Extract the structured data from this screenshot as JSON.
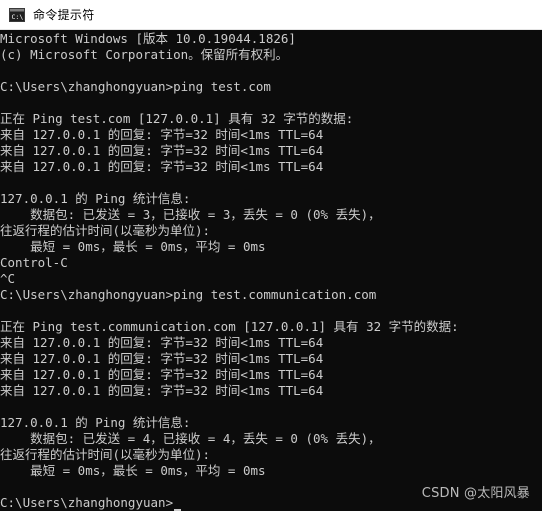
{
  "window": {
    "title": "命令提示符",
    "icon": "terminal-icon"
  },
  "console": {
    "lines": [
      "Microsoft Windows [版本 10.0.19044.1826]",
      "(c) Microsoft Corporation。保留所有权利。",
      "",
      "C:\\Users\\zhanghongyuan>ping test.com",
      "",
      "正在 Ping test.com [127.0.0.1] 具有 32 字节的数据:",
      "来自 127.0.0.1 的回复: 字节=32 时间<1ms TTL=64",
      "来自 127.0.0.1 的回复: 字节=32 时间<1ms TTL=64",
      "来自 127.0.0.1 的回复: 字节=32 时间<1ms TTL=64",
      "",
      "127.0.0.1 的 Ping 统计信息:",
      "    数据包: 已发送 = 3，已接收 = 3，丢失 = 0 (0% 丢失)，",
      "往返行程的估计时间(以毫秒为单位):",
      "    最短 = 0ms，最长 = 0ms，平均 = 0ms",
      "Control-C",
      "^C",
      "C:\\Users\\zhanghongyuan>ping test.communication.com",
      "",
      "正在 Ping test.communication.com [127.0.0.1] 具有 32 字节的数据:",
      "来自 127.0.0.1 的回复: 字节=32 时间<1ms TTL=64",
      "来自 127.0.0.1 的回复: 字节=32 时间<1ms TTL=64",
      "来自 127.0.0.1 的回复: 字节=32 时间<1ms TTL=64",
      "来自 127.0.0.1 的回复: 字节=32 时间<1ms TTL=64",
      "",
      "127.0.0.1 的 Ping 统计信息:",
      "    数据包: 已发送 = 4，已接收 = 4，丢失 = 0 (0% 丢失)，",
      "往返行程的估计时间(以毫秒为单位):",
      "    最短 = 0ms，最长 = 0ms，平均 = 0ms",
      "",
      "C:\\Users\\zhanghongyuan>"
    ]
  },
  "watermark": {
    "text": "CSDN @太阳风暴"
  },
  "colors": {
    "background": "#0c0c0c",
    "foreground": "#cccccc",
    "titlebar": "#ffffff"
  }
}
